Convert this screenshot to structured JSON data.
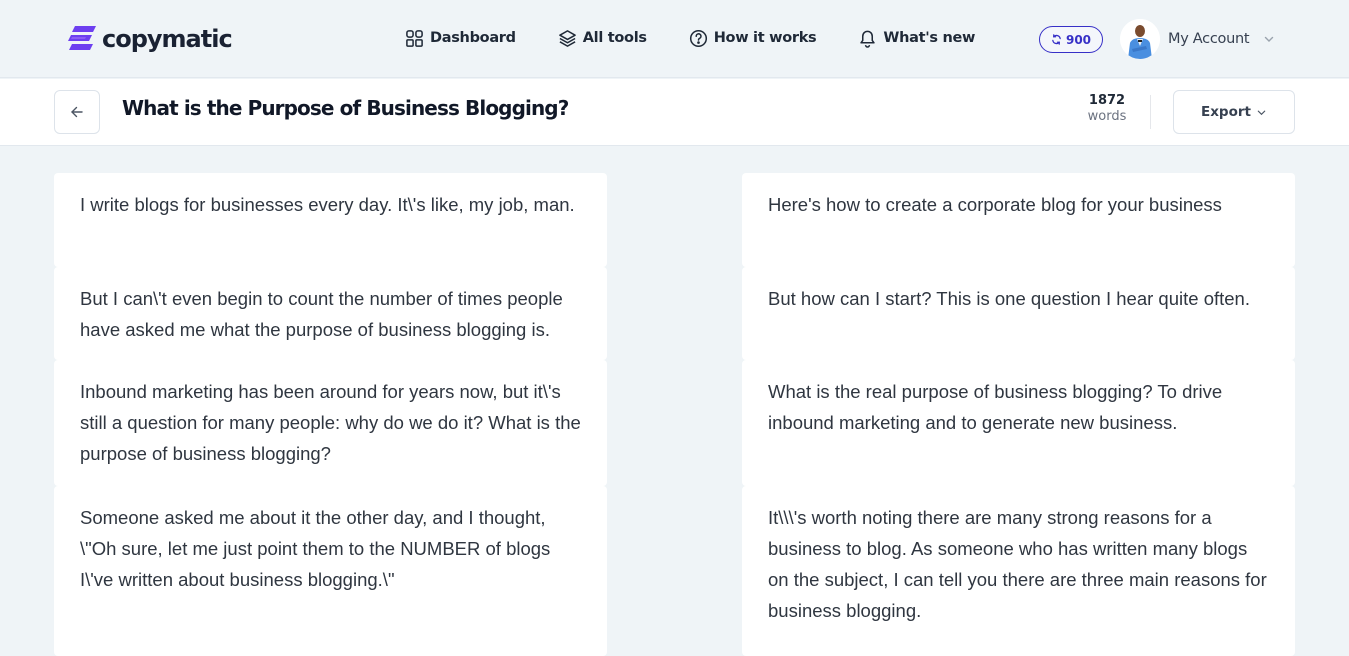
{
  "brand": {
    "name": "copymatic",
    "accent_color": "#6d3ff0",
    "logo_icon": "copymatic-stripes-logo-icon"
  },
  "nav": {
    "links": [
      {
        "label": "Dashboard",
        "icon": "grid-icon"
      },
      {
        "label": "All tools",
        "icon": "layers-icon"
      },
      {
        "label": "How it works",
        "icon": "question-circle-icon"
      },
      {
        "label": "What's new",
        "icon": "bell-icon"
      }
    ],
    "credits": {
      "value": "900",
      "icon": "refresh-icon",
      "color": "#3730c7"
    },
    "account": {
      "label": "My Account",
      "icon": "chevron-down-icon"
    }
  },
  "document": {
    "back_icon": "arrow-left-icon",
    "title": "What is the Purpose of Business Blogging?",
    "word_count": "1872",
    "word_count_unit": "words",
    "export_label": "Export",
    "export_icon": "chevron-down-icon"
  },
  "columns": {
    "left": [
      "I write blogs for businesses every day. It\\'s like, my job, man.",
      "But I can\\'t even begin to count the number of times people have asked me what the purpose of business blogging is.",
      "Inbound marketing has been around for years now, but it\\'s still a question for many people: why do we do it? What is the purpose of business blogging?",
      "Someone asked me about it the other day, and I thought, \\\"Oh sure, let me just point them to the NUMBER of blogs I\\'ve written about business blogging.\\\""
    ],
    "right": [
      "Here's how to create a corporate blog for your business",
      "But how can I start? This is one question I hear quite often.",
      "What is the real purpose of business blogging? To drive inbound marketing and to generate new business.",
      "It\\\\\\'s worth noting there are many strong reasons for a business to blog. As someone who has written many blogs on the subject, I can tell you there are three main reasons for business blogging."
    ]
  }
}
